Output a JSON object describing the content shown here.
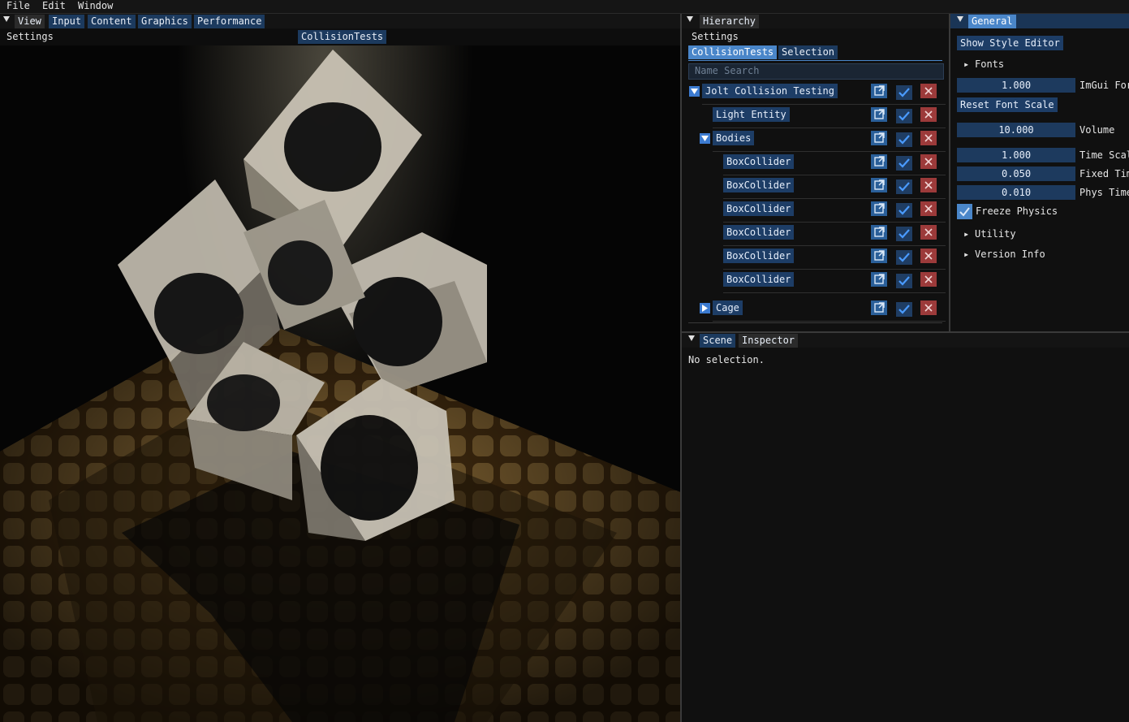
{
  "menu": [
    "File",
    "Edit",
    "Window"
  ],
  "main_window": {
    "tabs": [
      "View",
      "Input",
      "Content",
      "Graphics",
      "Performance"
    ],
    "subbar_left": "Settings",
    "subbar_tab": "CollisionTests"
  },
  "hierarchy": {
    "tab": "Hierarchy",
    "subbar": "Settings",
    "tabs": [
      "CollisionTests",
      "Selection"
    ],
    "search_placeholder": "Name Search",
    "items": [
      {
        "label": "Jolt Collision Testing",
        "depth": 0,
        "arrow": "down"
      },
      {
        "label": "Light Entity",
        "depth": 1,
        "arrow": "none"
      },
      {
        "label": "Bodies",
        "depth": 1,
        "arrow": "down"
      },
      {
        "label": "BoxCollider",
        "depth": 2,
        "arrow": "none"
      },
      {
        "label": "BoxCollider",
        "depth": 2,
        "arrow": "none"
      },
      {
        "label": "BoxCollider",
        "depth": 2,
        "arrow": "none"
      },
      {
        "label": "BoxCollider",
        "depth": 2,
        "arrow": "none"
      },
      {
        "label": "BoxCollider",
        "depth": 2,
        "arrow": "none"
      },
      {
        "label": "BoxCollider",
        "depth": 2,
        "arrow": "none"
      },
      {
        "label": "Cage",
        "depth": 1,
        "arrow": "right"
      }
    ]
  },
  "general": {
    "tab": "General",
    "style_button": "Show Style Editor",
    "fonts": "Fonts",
    "font_scale_value": "1.000",
    "font_scale_label": "ImGui For",
    "reset_font_button": "Reset Font Scale",
    "fields": [
      {
        "value": "10.000",
        "label": "Volume"
      },
      {
        "value": "1.000",
        "label": "Time Scal"
      },
      {
        "value": "0.050",
        "label": "Fixed Tim"
      },
      {
        "value": "0.010",
        "label": "Phys Time"
      }
    ],
    "freeze_label": "Freeze Physics",
    "freeze_checked": true,
    "utility": "Utility",
    "version_info": "Version Info"
  },
  "scene_panel": {
    "tabs": [
      "Scene",
      "Inspector"
    ],
    "message": "No selection."
  },
  "colors": {
    "accent": "#4a86c9",
    "button": "#1d3d66",
    "delete": "#9c3a3a"
  }
}
